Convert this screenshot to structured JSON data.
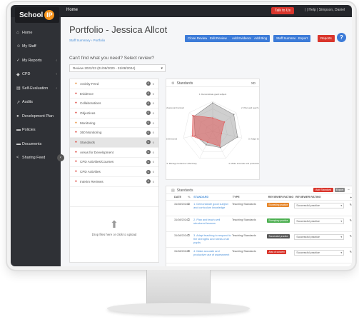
{
  "app": {
    "logo_text": "School",
    "logo_badge": "IP",
    "home": "Home",
    "talk_btn": "Talk to Us",
    "top_icons": "|  |  Help  |  Simpson, Daniel"
  },
  "sidebar": {
    "items": [
      {
        "label": "Home",
        "icon": "home-icon",
        "glyph": "⌂",
        "arrow": ""
      },
      {
        "label": "My Staff",
        "icon": "users-icon",
        "glyph": "☺",
        "arrow": ""
      },
      {
        "label": "My Reports",
        "icon": "check-icon",
        "glyph": "✓",
        "arrow": "‹"
      },
      {
        "label": "CPD",
        "icon": "diamond-icon",
        "glyph": "◆",
        "arrow": "‹"
      },
      {
        "label": "Self-Evaluation",
        "icon": "clipboard-icon",
        "glyph": "▤",
        "arrow": "‹"
      },
      {
        "label": "Audits",
        "icon": "chart-icon",
        "glyph": "↗",
        "arrow": ""
      },
      {
        "label": "Development Plan",
        "icon": "target-icon",
        "glyph": "●",
        "arrow": ""
      },
      {
        "label": "Policies",
        "icon": "folder-icon",
        "glyph": "▬",
        "arrow": ""
      },
      {
        "label": "Documents",
        "icon": "document-icon",
        "glyph": "▬",
        "arrow": ""
      },
      {
        "label": "Sharing Feed",
        "icon": "share-icon",
        "glyph": "<",
        "arrow": ""
      }
    ]
  },
  "header": {
    "title": "Portfolio - Jessica Allcot",
    "breadcrumb": "Staff Summary › Portfolio",
    "buttons": [
      {
        "label": "Close Review",
        "color": "#3c7bd8"
      },
      {
        "label": "Edit Review",
        "color": "#3c7bd8"
      },
      {
        "label": "Add Evidence",
        "color": "#3c7bd8"
      },
      {
        "label": "Add Blog",
        "color": "#3c7bd8"
      },
      {
        "label": "Staff Summary",
        "color": "#3c7bd8"
      },
      {
        "label": "Export",
        "color": "#3c7bd8"
      },
      {
        "label": "Reports",
        "color": "#d9352c"
      }
    ],
    "help": "?"
  },
  "review": {
    "question": "Can't find what you need? Select review?",
    "selected": "Review 2022/23 (01/09/2020 - 31/08/2024)"
  },
  "menu": {
    "items": [
      {
        "label": "Activity Feed",
        "count": "0",
        "count2": "0",
        "color": "#e6862a"
      },
      {
        "label": "Evidence",
        "count": "0",
        "count2": "0",
        "color": "#d9352c"
      },
      {
        "label": "Collaborations",
        "count": "0",
        "count2": "0",
        "color": "#d9352c"
      },
      {
        "label": "Objectives",
        "count": "0",
        "count2": "0",
        "color": "#d9352c"
      },
      {
        "label": "Monitoring",
        "count": "0",
        "count2": "0",
        "color": "#e6862a"
      },
      {
        "label": "360 Monitoring",
        "count": "0",
        "count2": "0",
        "color": "#d9352c"
      },
      {
        "label": "Standards",
        "count": "0",
        "count2": "0",
        "color": "#d9352c"
      },
      {
        "label": "Areas for Development",
        "count": "0",
        "count2": "0",
        "color": "#d9352c"
      },
      {
        "label": "CPD Activities/Courses",
        "count": "0",
        "count2": "0",
        "color": "#d9352c"
      },
      {
        "label": "CPD Activities",
        "count": "0",
        "count2": "0",
        "color": "#d9352c"
      },
      {
        "label": "Interim Reviews",
        "count": "0",
        "count2": "0",
        "color": "#d9352c"
      }
    ],
    "active_index": 6,
    "upload_text": "Drop files here or click to upload"
  },
  "standards_chart": {
    "title": "Standards",
    "controls": "XD",
    "axis_labels": [
      "1. Demonstrate good subject",
      "2. Plan and teach well lessons",
      "3. Adapt teaching to respond",
      "4. Make accurate and productive",
      "5. Manage behaviour effectively",
      "6. Fulfil wider professional",
      "Personal and Professional Conduct"
    ]
  },
  "chart_data": {
    "type": "radar",
    "categories": [
      "1",
      "2",
      "3",
      "4",
      "5",
      "6",
      "7"
    ],
    "series": [
      {
        "name": "",
        "values": [
          0.45,
          0.5,
          0.3,
          0.55,
          0.4,
          0.7,
          0.85
        ],
        "color": "#e05a5a"
      },
      {
        "name": "",
        "values": [
          0.95,
          0.9,
          0.85,
          0.6,
          0.5,
          0.6,
          0.8
        ],
        "color": "#888888"
      }
    ],
    "ylim": [
      0,
      1
    ]
  },
  "standards_table": {
    "title": "Standards",
    "headers": [
      "DATE",
      "",
      "STANDARD",
      "TYPE",
      "REVIEWER RATING",
      "REVIEWER RATING"
    ],
    "rows": [
      {
        "date": "31/08/2024",
        "std": "1. Demonstrate good subject and curriculum knowledge",
        "type": "Teaching Standards",
        "badge": "Exceeding practice",
        "badge_color": "#e6862a",
        "rating": "Successful practice"
      },
      {
        "date": "31/08/2024",
        "std": "2. Plan and teach well structured lessons",
        "type": "Teaching Standards",
        "badge": "Exemplary practice",
        "badge_color": "#4caf50",
        "rating": "Successful practice"
      },
      {
        "date": "31/08/2024",
        "std": "3. Adapt teaching to respond to the strengths and needs of all pupils",
        "type": "Teaching Standards",
        "badge": "Successful practice",
        "badge_color": "#555555",
        "rating": "Successful practice"
      },
      {
        "date": "31/08/2024",
        "std": "4. Make accurate and productive use of assessment",
        "type": "Teaching Standards",
        "badge": "Area of concern",
        "badge_color": "#d9352c",
        "rating": "Successful practice"
      }
    ],
    "add_btn": "Add Standard",
    "export_btn": "Export"
  }
}
